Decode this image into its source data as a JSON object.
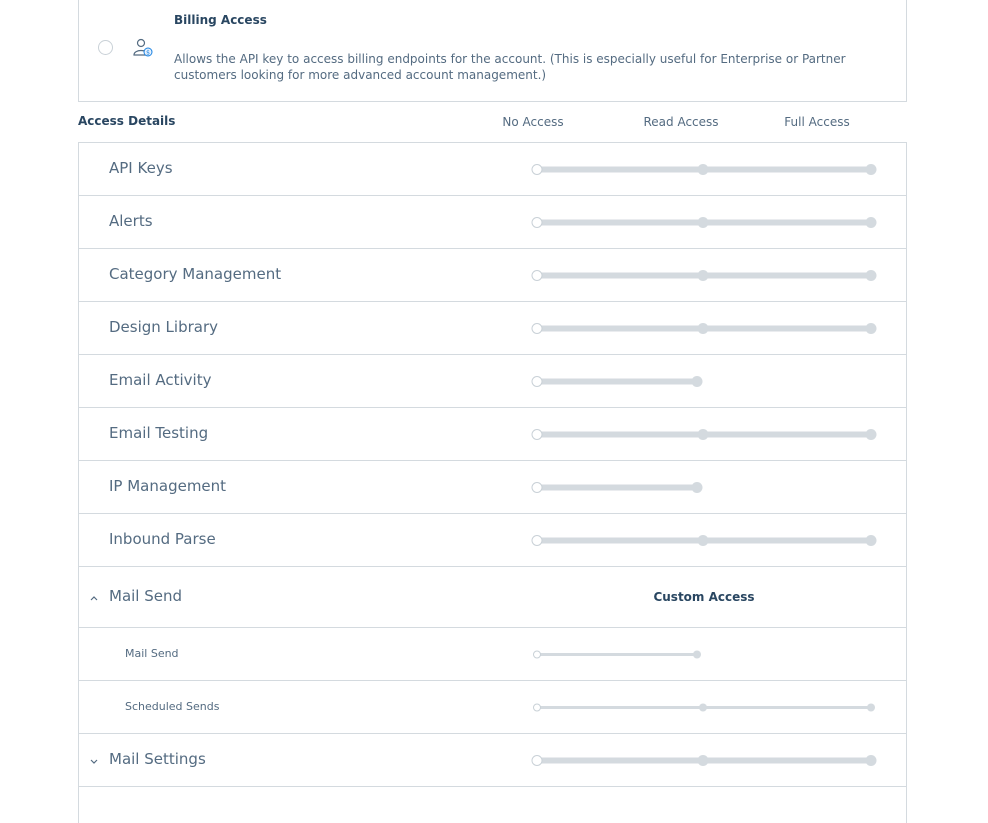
{
  "billing": {
    "title": "Billing Access",
    "description": "Allows the API key to access billing endpoints for the account. (This is especially useful for Enterprise or Partner customers looking for more advanced account management.)"
  },
  "access": {
    "title": "Access Details",
    "columns": [
      "No Access",
      "Read Access",
      "Full Access"
    ]
  },
  "rows": [
    {
      "label": "API Keys",
      "levels": 3
    },
    {
      "label": "Alerts",
      "levels": 3
    },
    {
      "label": "Category Management",
      "levels": 3
    },
    {
      "label": "Design Library",
      "levels": 3
    },
    {
      "label": "Email Activity",
      "levels": 2
    },
    {
      "label": "Email Testing",
      "levels": 3
    },
    {
      "label": "IP Management",
      "levels": 2
    },
    {
      "label": "Inbound Parse",
      "levels": 3
    },
    {
      "label": "Mail Send",
      "group": true,
      "expanded": true,
      "status": "Custom Access"
    },
    {
      "label": "Mail Send",
      "sub": true,
      "levels": 2
    },
    {
      "label": "Scheduled Sends",
      "sub": true,
      "levels": 3
    },
    {
      "label": "Mail Settings",
      "group": true,
      "expanded": false,
      "levels": 3
    }
  ],
  "colors": {
    "track": "#d4dadf",
    "knob": "#d4dadf",
    "title": "#294661",
    "text": "#546b81"
  }
}
